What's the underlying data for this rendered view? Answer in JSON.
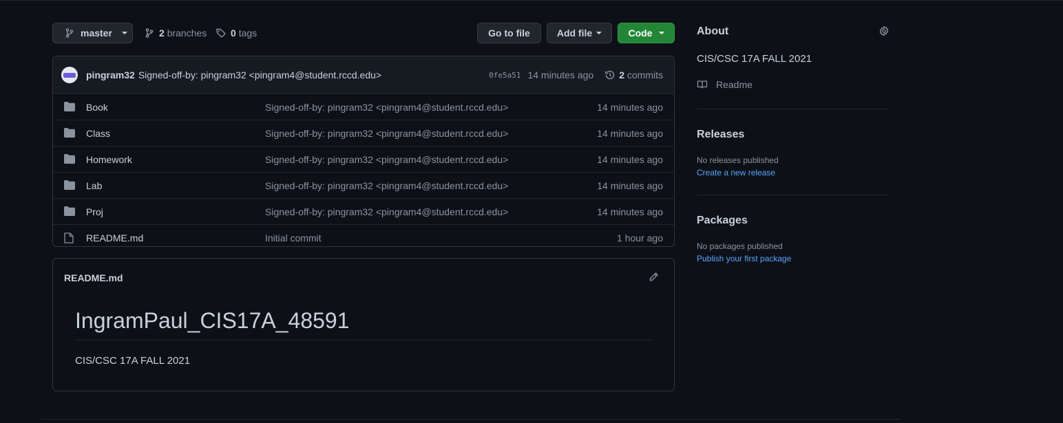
{
  "toolbar": {
    "branch": "master",
    "branches_count": "2",
    "branches_label": "branches",
    "tags_count": "0",
    "tags_label": "tags",
    "go_to_file": "Go to file",
    "add_file": "Add file",
    "code": "Code"
  },
  "commit": {
    "author": "pingram32",
    "message": "Signed-off-by: pingram32 <pingram4@student.rccd.edu>",
    "sha": "0fe5a51",
    "age": "14 minutes ago",
    "commits_count": "2",
    "commits_label": "commits"
  },
  "files": [
    {
      "type": "folder",
      "name": "Book",
      "message": "Signed-off-by: pingram32 <pingram4@student.rccd.edu>",
      "age": "14 minutes ago"
    },
    {
      "type": "folder",
      "name": "Class",
      "message": "Signed-off-by: pingram32 <pingram4@student.rccd.edu>",
      "age": "14 minutes ago"
    },
    {
      "type": "folder",
      "name": "Homework",
      "message": "Signed-off-by: pingram32 <pingram4@student.rccd.edu>",
      "age": "14 minutes ago"
    },
    {
      "type": "folder",
      "name": "Lab",
      "message": "Signed-off-by: pingram32 <pingram4@student.rccd.edu>",
      "age": "14 minutes ago"
    },
    {
      "type": "folder",
      "name": "Proj",
      "message": "Signed-off-by: pingram32 <pingram4@student.rccd.edu>",
      "age": "14 minutes ago"
    },
    {
      "type": "file",
      "name": "README.md",
      "message": "Initial commit",
      "age": "1 hour ago"
    }
  ],
  "readme": {
    "filename": "README.md",
    "heading": "IngramPaul_CIS17A_48591",
    "body": "CIS/CSC 17A FALL 2021"
  },
  "sidebar": {
    "about_title": "About",
    "description": "CIS/CSC 17A FALL 2021",
    "readme_link": "Readme",
    "releases_title": "Releases",
    "releases_empty": "No releases published",
    "releases_link": "Create a new release",
    "packages_title": "Packages",
    "packages_empty": "No packages published",
    "packages_link": "Publish your first package"
  },
  "colors": {
    "background": "#0d1117",
    "accent_link": "#58a6ff",
    "code_button": "#238636"
  },
  "icons": [
    "branch-icon",
    "tag-icon",
    "history-icon",
    "folder-icon",
    "file-icon",
    "pencil-icon",
    "gear-icon",
    "book-icon"
  ]
}
